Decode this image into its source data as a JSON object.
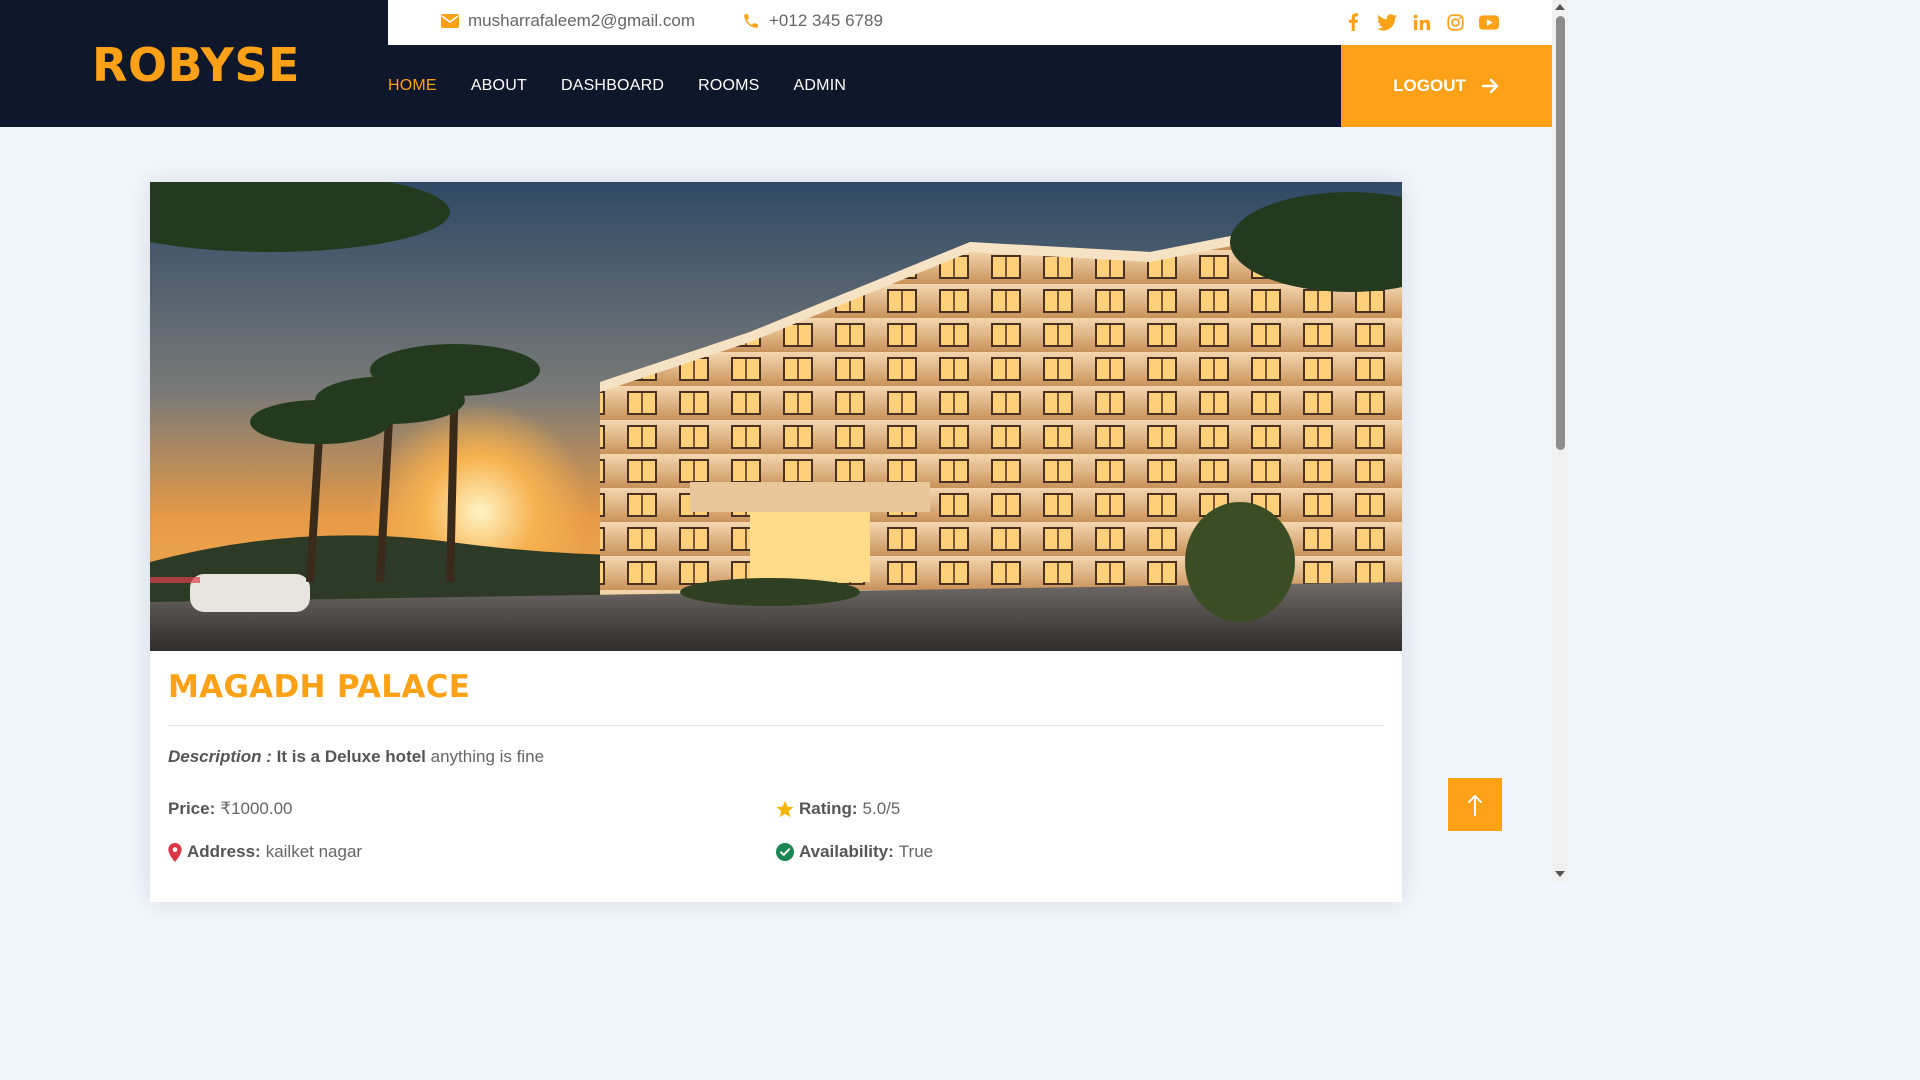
{
  "brand": {
    "name": "ROBYSE"
  },
  "topbar": {
    "email": "musharrafaleem2@gmail.com",
    "phone": "+012 345 6789",
    "socials": [
      "facebook-icon",
      "twitter-icon",
      "linkedin-icon",
      "instagram-icon",
      "youtube-icon"
    ]
  },
  "nav": {
    "items": [
      {
        "label": "HOME",
        "active": true
      },
      {
        "label": "ABOUT"
      },
      {
        "label": "DASHBOARD"
      },
      {
        "label": "ROOMS"
      },
      {
        "label": "ADMIN"
      }
    ],
    "logout_label": "LOGOUT"
  },
  "hotel": {
    "name": "MAGADH PALACE",
    "description_label": "Description :",
    "description_bold": "It is a Deluxe hotel",
    "description_rest": " anything is fine",
    "price_label": "Price:",
    "price_value": "₹1000.00",
    "rating_label": "Rating:",
    "rating_value": "5.0/5",
    "address_label": "Address:",
    "address_value": "kailket nagar",
    "availability_label": "Availability:",
    "availability_value": "True"
  },
  "colors": {
    "accent": "#fea116",
    "dark": "#0f172b",
    "page_bg": "#f1f6fc"
  }
}
